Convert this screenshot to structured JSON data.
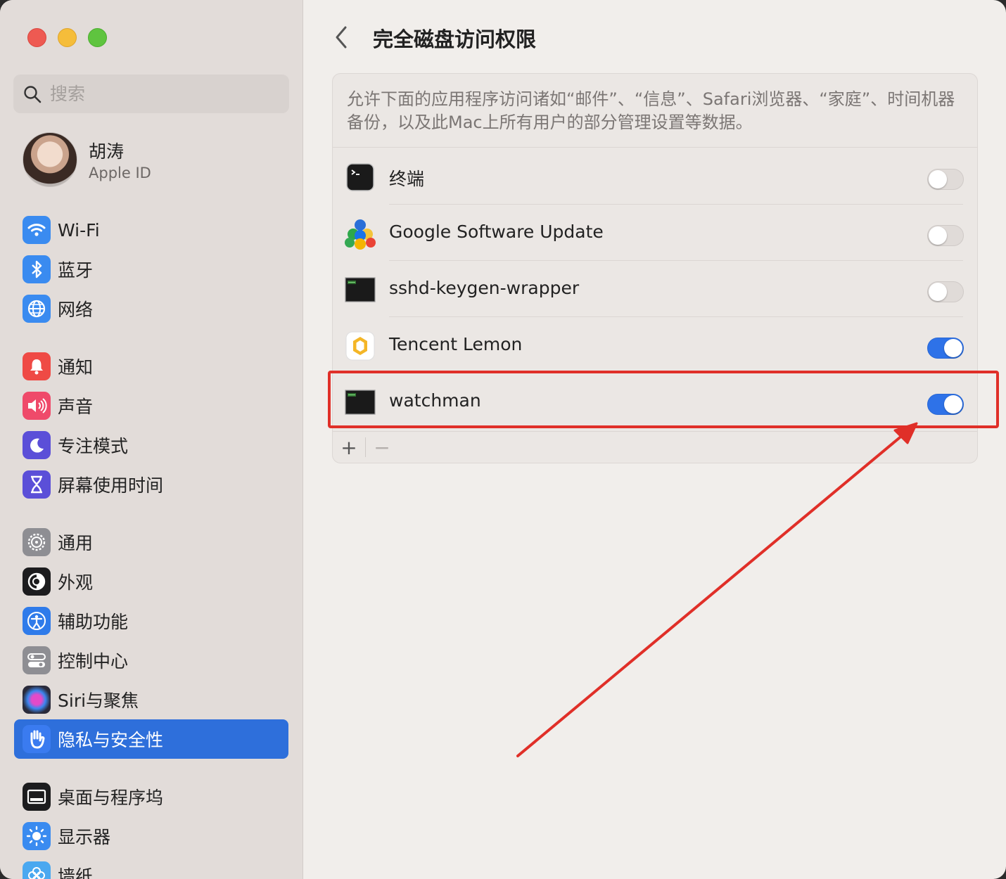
{
  "sidebar": {
    "search_placeholder": "搜索",
    "profile": {
      "name": "胡涛",
      "subtitle": "Apple ID"
    },
    "items": [
      {
        "label": "Wi-Fi",
        "icon": "wifi-icon",
        "color": "#3a8bf0"
      },
      {
        "label": "蓝牙",
        "icon": "bluetooth-icon",
        "color": "#3a8bf0"
      },
      {
        "label": "网络",
        "icon": "globe-icon",
        "color": "#3a8bf0"
      },
      {
        "label": "通知",
        "icon": "bell-icon",
        "color": "#ef4a45"
      },
      {
        "label": "声音",
        "icon": "speaker-icon",
        "color": "#ef4a6a"
      },
      {
        "label": "专注模式",
        "icon": "moon-icon",
        "color": "#5b4fd8"
      },
      {
        "label": "屏幕使用时间",
        "icon": "hourglass-icon",
        "color": "#5b4fd8"
      },
      {
        "label": "通用",
        "icon": "gear-icon",
        "color": "#8e8e93"
      },
      {
        "label": "外观",
        "icon": "appearance-icon",
        "color": "#1c1c1e"
      },
      {
        "label": "辅助功能",
        "icon": "accessibility-icon",
        "color": "#2f7bea"
      },
      {
        "label": "控制中心",
        "icon": "control-center-icon",
        "color": "#8e8e93"
      },
      {
        "label": "Siri与聚焦",
        "icon": "siri-icon",
        "color": "#2a2a3a"
      },
      {
        "label": "隐私与安全性",
        "icon": "hand-icon",
        "color": "#3a7bf0",
        "selected": true
      },
      {
        "label": "桌面与程序坞",
        "icon": "dock-icon",
        "color": "#1c1c1e"
      },
      {
        "label": "显示器",
        "icon": "sun-icon",
        "color": "#3a8bf0"
      },
      {
        "label": "墙纸",
        "icon": "wallpaper-icon",
        "color": "#4aa8f0"
      }
    ]
  },
  "main": {
    "title": "完全磁盘访问权限",
    "description": "允许下面的应用程序访问诸如“邮件”、“信息”、Safari浏览器、“家庭”、时间机器备份，以及此Mac上所有用户的部分管理设置等数据。",
    "apps": [
      {
        "name": "终端",
        "icon": "terminal-icon",
        "enabled": false
      },
      {
        "name": "Google Software Update",
        "icon": "google-software-update-icon",
        "enabled": false
      },
      {
        "name": "sshd-keygen-wrapper",
        "icon": "exec-icon",
        "enabled": false
      },
      {
        "name": "Tencent Lemon",
        "icon": "tencent-lemon-icon",
        "enabled": true
      },
      {
        "name": "watchman",
        "icon": "exec-icon",
        "enabled": true
      }
    ],
    "add_label": "+",
    "remove_label": "−"
  },
  "annotation": {
    "color": "#e02f28"
  }
}
